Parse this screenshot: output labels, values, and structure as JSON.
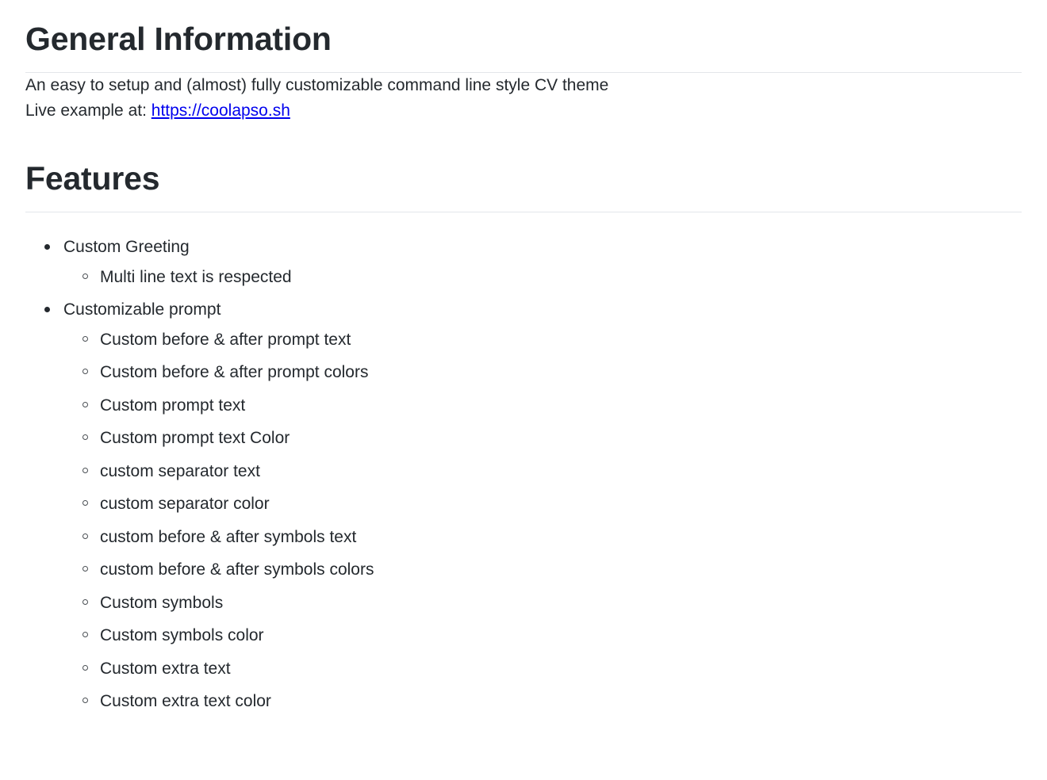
{
  "document": {
    "sections": [
      {
        "id": "general-information",
        "heading": "General Information",
        "paragraphs": [
          {
            "text": "An easy to setup and (almost) fully customizable command line style CV theme"
          }
        ],
        "link_line": {
          "prefix": "Live example at: ",
          "link_text": "https://coolapso.sh"
        }
      },
      {
        "id": "features",
        "heading": "Features",
        "items": [
          {
            "label": "Custom Greeting",
            "children": [
              "Multi line text is respected"
            ]
          },
          {
            "label": "Customizable prompt",
            "children": [
              "Custom before & after prompt text",
              "Custom before & after prompt colors",
              "Custom prompt text",
              "Custom prompt text Color",
              "custom separator text",
              "custom separator color",
              "custom before & after symbols text",
              "custom before & after symbols colors",
              "Custom symbols",
              "Custom symbols color",
              "Custom extra text",
              "Custom extra text color"
            ]
          }
        ]
      }
    ],
    "colors": {
      "text": "#24292e",
      "link": "#0000ee",
      "rule": "#e3e6ea",
      "background": "#ffffff"
    }
  }
}
